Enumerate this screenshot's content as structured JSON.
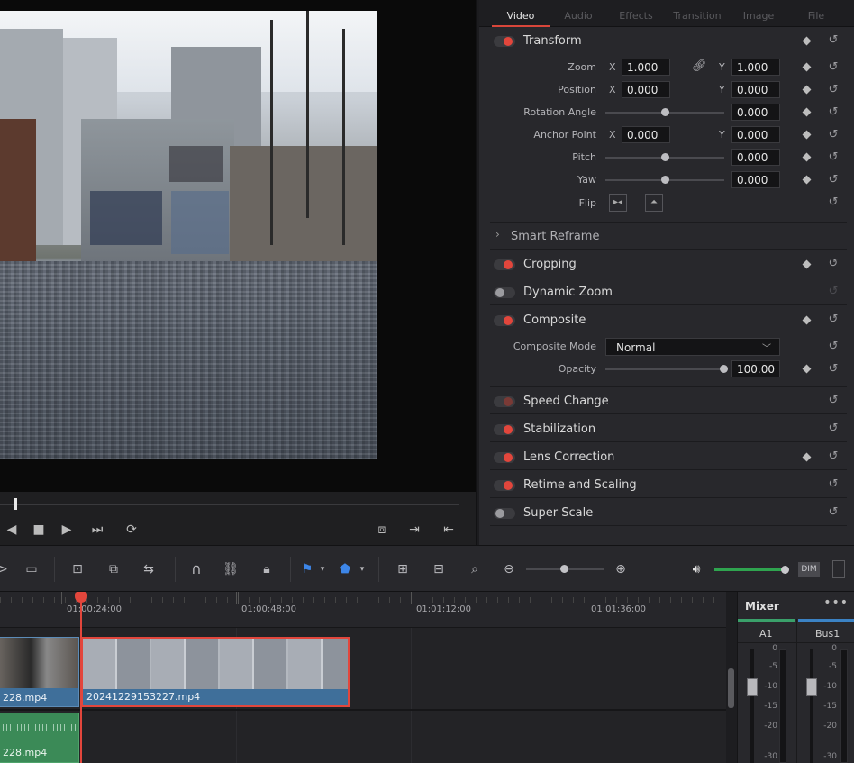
{
  "inspector": {
    "tabs": [
      {
        "label": "Video",
        "active": true
      },
      {
        "label": "Audio",
        "active": false
      },
      {
        "label": "Effects",
        "active": false
      },
      {
        "label": "Transition",
        "active": false
      },
      {
        "label": "Image",
        "active": false
      },
      {
        "label": "File",
        "active": false
      }
    ],
    "transform": {
      "title": "Transform",
      "zoom": {
        "label": "Zoom",
        "x_axis": "X",
        "x": "1.000",
        "y_axis": "Y",
        "y": "1.000"
      },
      "position": {
        "label": "Position",
        "x_axis": "X",
        "x": "0.000",
        "y_axis": "Y",
        "y": "0.000"
      },
      "rotation": {
        "label": "Rotation Angle",
        "value": "0.000"
      },
      "anchor": {
        "label": "Anchor Point",
        "x_axis": "X",
        "x": "0.000",
        "y_axis": "Y",
        "y": "0.000"
      },
      "pitch": {
        "label": "Pitch",
        "value": "0.000"
      },
      "yaw": {
        "label": "Yaw",
        "value": "0.000"
      },
      "flip": {
        "label": "Flip"
      }
    },
    "smart_reframe": {
      "title": "Smart Reframe"
    },
    "cropping": {
      "title": "Cropping"
    },
    "dynamic_zoom": {
      "title": "Dynamic Zoom"
    },
    "composite": {
      "title": "Composite",
      "mode_label": "Composite Mode",
      "mode_value": "Normal",
      "opacity_label": "Opacity",
      "opacity_value": "100.00"
    },
    "speed_change": {
      "title": "Speed Change"
    },
    "stabilization": {
      "title": "Stabilization"
    },
    "lens_correction": {
      "title": "Lens Correction"
    },
    "retime": {
      "title": "Retime and Scaling"
    },
    "super_scale": {
      "title": "Super Scale"
    }
  },
  "toolbar": {
    "dim_label": "DIM"
  },
  "timeline": {
    "timecodes": [
      "01:00:24:00",
      "01:00:48:00",
      "01:01:12:00",
      "01:01:36:00"
    ],
    "clips": [
      {
        "video_name": "228.mp4",
        "audio_name": "228.mp4"
      },
      {
        "video_name": "20241229153227.mp4"
      }
    ]
  },
  "mixer": {
    "title": "Mixer",
    "menu": "•••",
    "channels": [
      "A1",
      "Bus1"
    ],
    "scale": [
      "0",
      "-5",
      "-10",
      "-15",
      "-20",
      "-30"
    ]
  },
  "colors": {
    "accent_red": "#e2463c",
    "clip_video": "#3f6f9a",
    "clip_audio": "#3b8a57",
    "volume_green": "#2fa44f"
  }
}
